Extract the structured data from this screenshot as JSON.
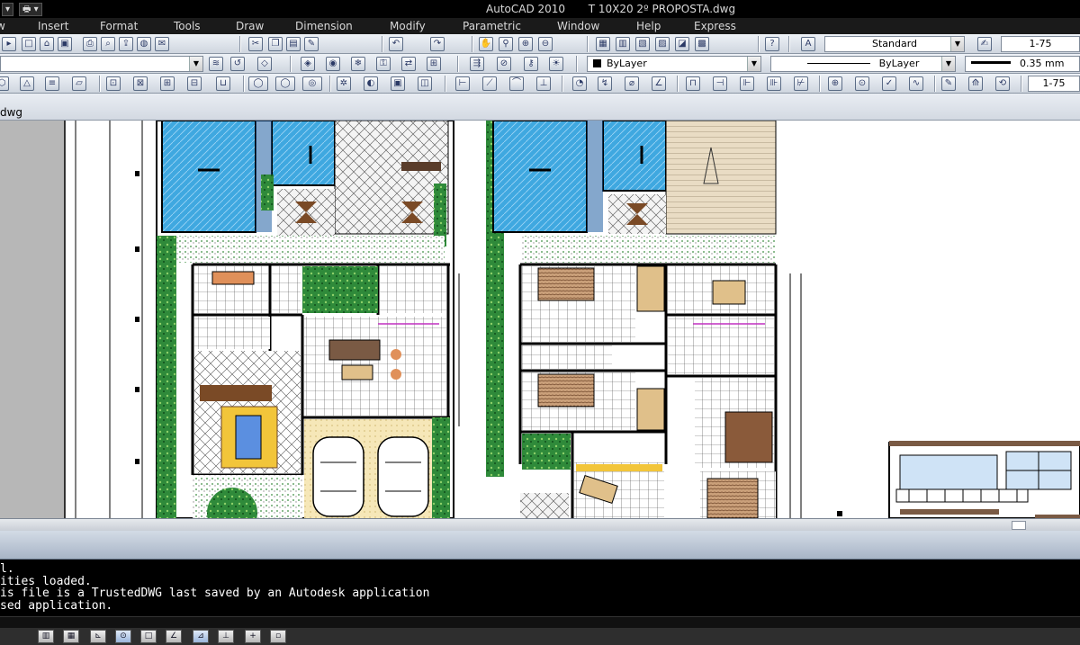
{
  "title_bar": {
    "window_title": "AutoCAD 2010",
    "file_name": "T 10X20 2º PROPOSTA.dwg",
    "quick_access": [
      "▾",
      "🖶 ▾"
    ]
  },
  "menu": [
    "Insert",
    "Format",
    "Tools",
    "Draw",
    "Dimension",
    "Modify",
    "Parametric",
    "Window",
    "Help",
    "Express"
  ],
  "toolbar_styles": {
    "text_style": "Standard",
    "dim_scale": "1-75"
  },
  "toolbar_properties": {
    "color": "ByLayer",
    "linetype": "ByLayer",
    "lineweight": "0.35 mm"
  },
  "toolbar_dimension": {
    "dim_style": "1-75"
  },
  "document_tab": "dwg",
  "command_history": [
    "l.",
    "ities loaded.",
    "is file is a TrustedDWG last saved by an Autodesk application",
    "sed application."
  ],
  "colors": {
    "pool_water": "#3fa8e0",
    "garden_green": "#2f8a3a",
    "wall": "#111111",
    "deck_wood": "#e9dcc4",
    "furniture_brown": "#8a5a3a"
  },
  "icons": {
    "toolbar1": [
      "new-icon",
      "open-icon",
      "save-icon",
      "plot-icon",
      "plot-preview-icon",
      "publish-icon",
      "3d-dwf-icon",
      "etransmit-icon",
      "cut-icon",
      "copy-icon",
      "paste-icon",
      "match-properties-icon",
      "undo-icon",
      "redo-icon",
      "pan-icon",
      "zoom-realtime-icon",
      "zoom-window-icon",
      "zoom-previous-icon",
      "properties-icon",
      "design-center-icon",
      "tool-palettes-icon",
      "sheet-set-icon",
      "markup-icon",
      "calculator-icon",
      "help-icon"
    ],
    "toolbar3": [
      "layer-icon",
      "block-icon",
      "circle-icon",
      "dim-linear-icon",
      "dim-aligned-icon",
      "dim-arc-icon",
      "dim-ordinate-icon",
      "dim-radius-icon",
      "dim-diameter-icon",
      "dim-angular-icon",
      "quick-dim-icon",
      "dim-baseline-icon",
      "dim-continue-icon",
      "tolerance-icon",
      "center-mark-icon",
      "dim-edit-icon",
      "dim-update-icon"
    ]
  }
}
